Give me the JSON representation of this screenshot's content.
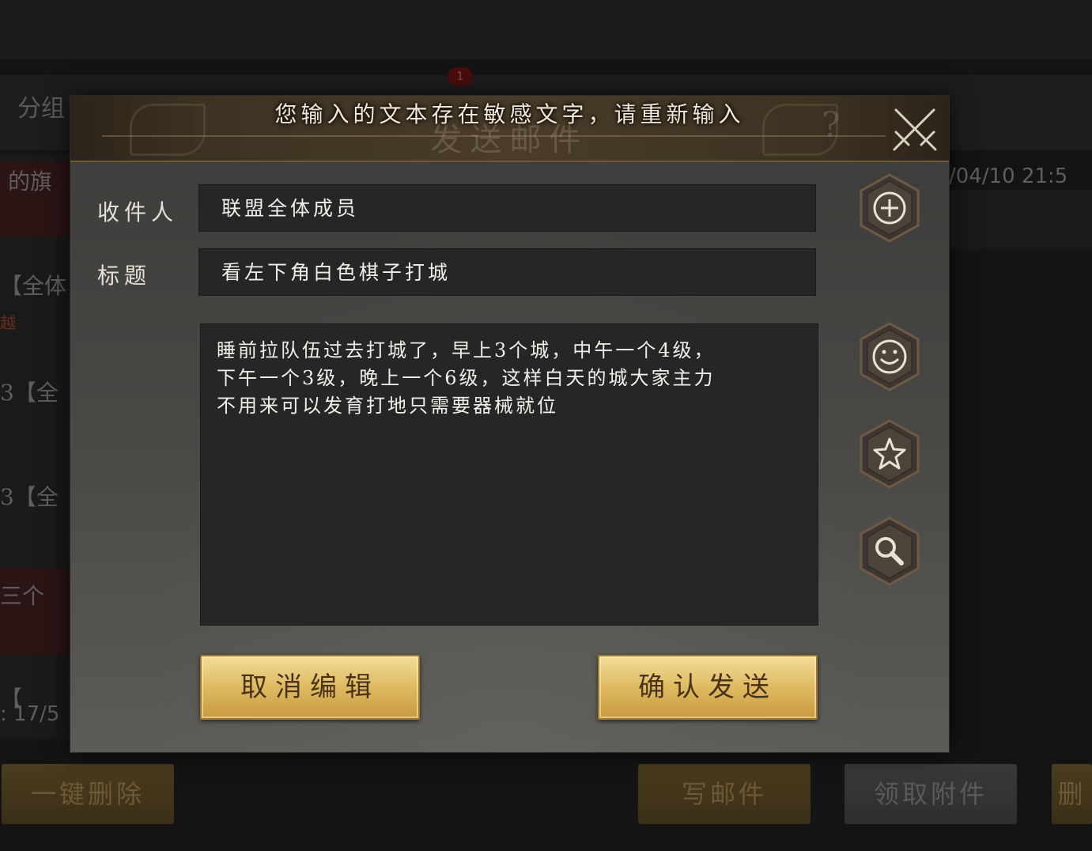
{
  "background": {
    "tab_label": "分组",
    "badge": "1",
    "rows": [
      "的旗",
      "【全体",
      "3【全",
      "3【全",
      "三个",
      "【"
    ],
    "row_sub": "越",
    "date": "/04/10   21:5",
    "count": ": 17/5",
    "buttons": {
      "delete_all": "一键删除",
      "write_mail": "写邮件",
      "claim_attachments": "领取附件",
      "delete_partial": "删"
    }
  },
  "dialog": {
    "title": "发送邮件",
    "notice": "您输入的文本存在敏感文字，请重新输入",
    "help_glyph": "?",
    "recipient_label": "收件人",
    "recipient_value": "联盟全体成员",
    "subject_label": "标题",
    "subject_value": "看左下角白色棋子打城",
    "body_text": "睡前拉队伍过去打城了，早上3个城，中午一个4级，\n下午一个3级，晚上一个6级，这样白天的城大家主力\n不用来可以发育打地只需要器械就位",
    "cancel_label": "取消编辑",
    "confirm_label": "确认发送"
  },
  "icons": {
    "close": "crossed-swords-icon",
    "add": "plus-circle-icon",
    "emoji": "smiley-icon",
    "favorite": "star-icon",
    "search": "magnifier-icon"
  },
  "colors": {
    "gold_button": "#e1bd66",
    "panel": "#4a4946",
    "input_bg": "#262626"
  }
}
